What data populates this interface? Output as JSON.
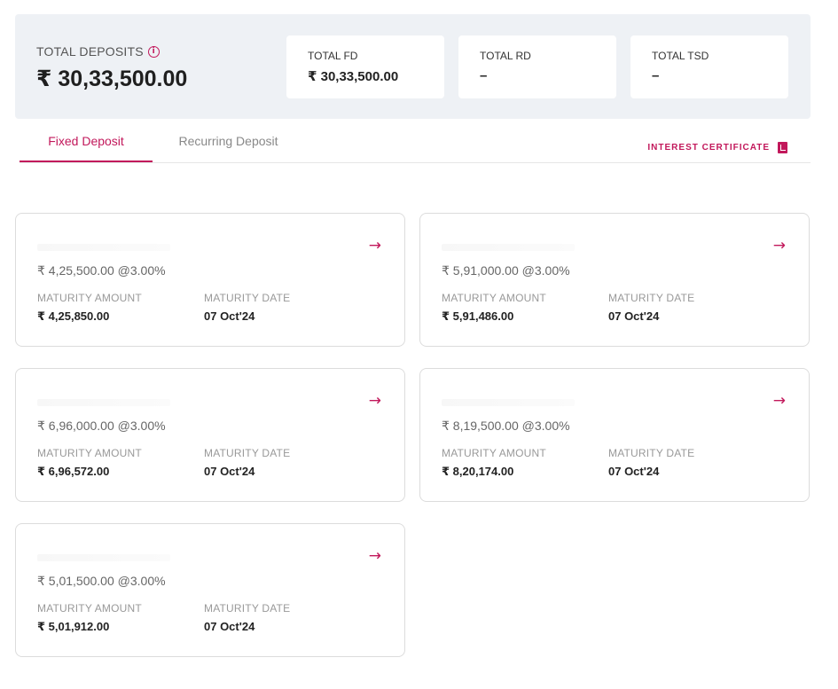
{
  "summary": {
    "total_label": "TOTAL DEPOSITS",
    "total_value": "₹ 30,33,500.00",
    "stats": [
      {
        "label": "TOTAL FD",
        "value": "₹ 30,33,500.00"
      },
      {
        "label": "TOTAL RD",
        "value": "–"
      },
      {
        "label": "TOTAL TSD",
        "value": "–"
      }
    ]
  },
  "tabs": [
    {
      "label": "Fixed Deposit",
      "active": true
    },
    {
      "label": "Recurring Deposit",
      "active": false
    }
  ],
  "interest_certificate": "INTEREST CERTIFICATE",
  "labels": {
    "maturity_amount": "MATURITY AMOUNT",
    "maturity_date": "MATURITY DATE"
  },
  "deposits": [
    {
      "principal": "₹ 4,25,500.00 @3.00%",
      "maturity_amount": "₹ 4,25,850.00",
      "maturity_date": "07 Oct'24"
    },
    {
      "principal": "₹ 5,91,000.00 @3.00%",
      "maturity_amount": "₹ 5,91,486.00",
      "maturity_date": "07 Oct'24"
    },
    {
      "principal": "₹ 6,96,000.00 @3.00%",
      "maturity_amount": "₹ 6,96,572.00",
      "maturity_date": "07 Oct'24"
    },
    {
      "principal": "₹ 8,19,500.00 @3.00%",
      "maturity_amount": "₹ 8,20,174.00",
      "maturity_date": "07 Oct'24"
    },
    {
      "principal": "₹ 5,01,500.00 @3.00%",
      "maturity_amount": "₹ 5,01,912.00",
      "maturity_date": "07 Oct'24"
    }
  ],
  "colors": {
    "accent": "#c2185b",
    "summary_bg": "#eef1f5"
  },
  "icons": {
    "info": "info-circle-icon",
    "certificate": "pdf-download-icon",
    "open": "arrow-right-icon"
  }
}
